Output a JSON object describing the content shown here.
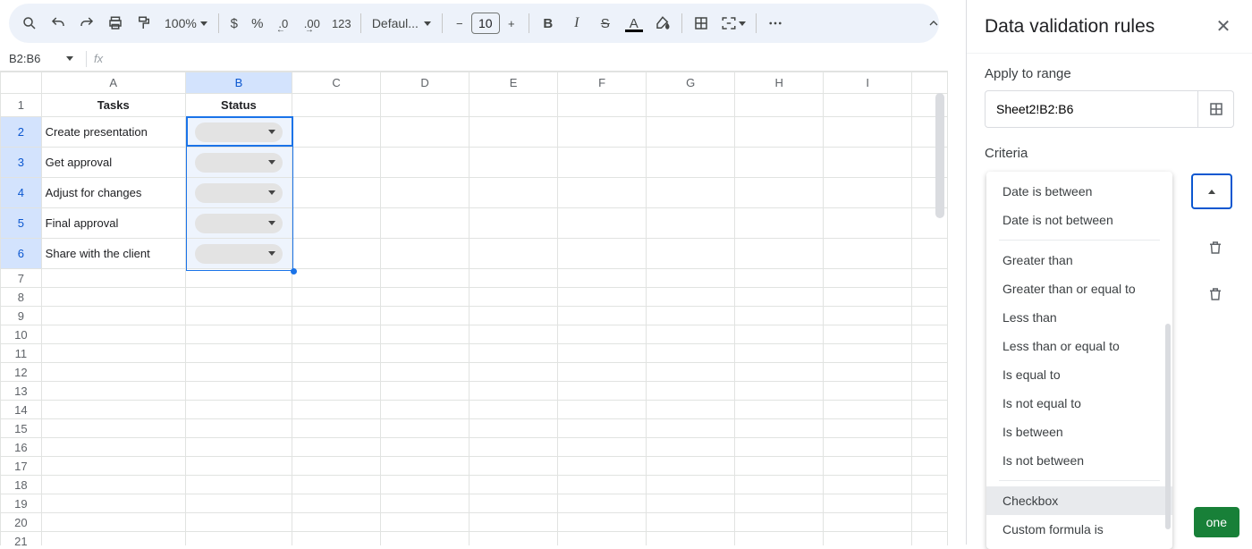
{
  "toolbar": {
    "zoom": "100%",
    "number_123": "123",
    "font_family": "Defaul...",
    "font_size": "10",
    "format_currency": "$",
    "format_percent": "%",
    "format_dec_dec": ".0",
    "format_dec_inc": ".00"
  },
  "name_box": "B2:B6",
  "columns": [
    "A",
    "B",
    "C",
    "D",
    "E",
    "F",
    "G",
    "H",
    "I"
  ],
  "row_numbers": [
    1,
    2,
    3,
    4,
    5,
    6,
    7,
    8,
    9,
    10,
    11,
    12,
    13,
    14,
    15,
    16,
    17,
    18,
    19,
    20,
    21
  ],
  "headers": {
    "tasks": "Tasks",
    "status": "Status"
  },
  "tasks": [
    "Create presentation",
    "Get approval",
    "Adjust for changes",
    "Final approval",
    "Share with the client"
  ],
  "side_panel": {
    "title": "Data validation rules",
    "apply_label": "Apply to range",
    "range_value": "Sheet2!B2:B6",
    "criteria_label": "Criteria",
    "done_label": "one",
    "criteria_options": [
      "Date is between",
      "Date is not between",
      "---",
      "Greater than",
      "Greater than or equal to",
      "Less than",
      "Less than or equal to",
      "Is equal to",
      "Is not equal to",
      "Is between",
      "Is not between",
      "---",
      "Checkbox",
      "Custom formula is"
    ],
    "highlighted_option": "Checkbox"
  }
}
